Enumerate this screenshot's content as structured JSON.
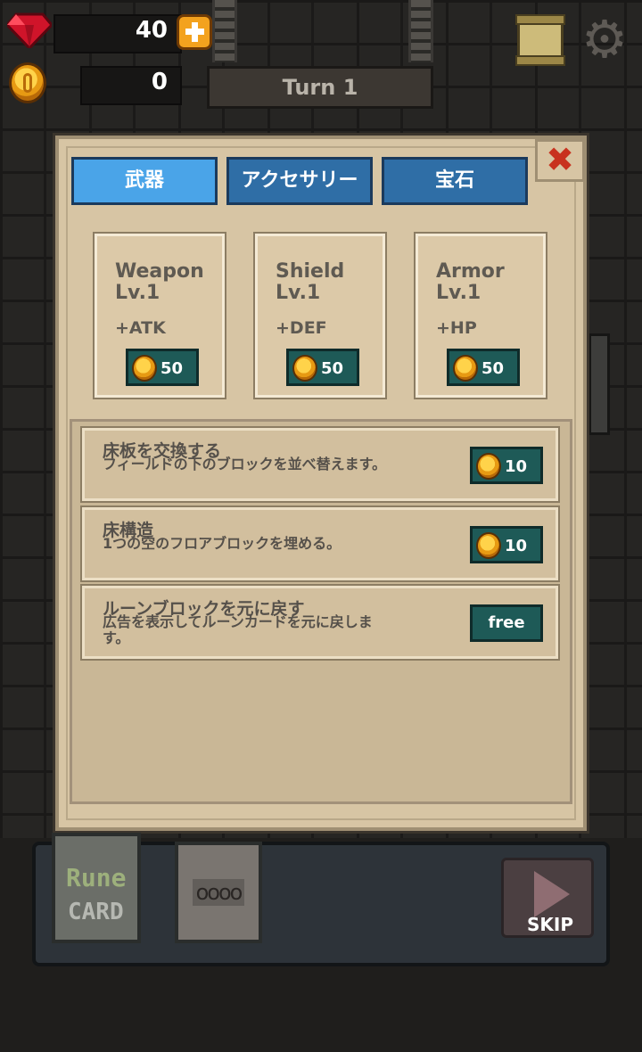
{
  "hud": {
    "gems": "40",
    "coins": "0",
    "turn_label": "Turn 1"
  },
  "tabs": [
    {
      "label": "武器",
      "active": true
    },
    {
      "label": "アクセサリー",
      "active": false
    },
    {
      "label": "宝石",
      "active": false
    }
  ],
  "items": [
    {
      "name": "Weapon Lv.1",
      "stat": "+ATK",
      "price": "50"
    },
    {
      "name": "Shield Lv.1",
      "stat": "+DEF",
      "price": "50"
    },
    {
      "name": "Armor Lv.1",
      "stat": "+HP",
      "price": "50"
    }
  ],
  "services": [
    {
      "title": "床板を交換する",
      "desc": "フィールドの下のブロックを並べ替えます。",
      "price": "10"
    },
    {
      "title": "床構造",
      "desc": "1つの空のフロアブロックを埋める。",
      "price": "10"
    },
    {
      "title": "ルーンブロックを元に戻す",
      "desc": "広告を表示してルーンカードを元に戻します。",
      "price": "free"
    }
  ],
  "tray": {
    "rune_card_top": "Rune",
    "rune_card_bottom": "CARD",
    "skip_label": "SKIP"
  },
  "colors": {
    "tab_active": "#4aa4e8",
    "tab_inactive": "#2f6ea6",
    "price_button": "#1e5a57",
    "close_icon": "#c8321f"
  }
}
